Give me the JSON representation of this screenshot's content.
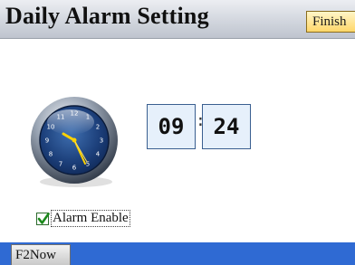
{
  "header": {
    "title": "Daily Alarm Setting",
    "finish_label": "Finish"
  },
  "clock": {
    "icon": "analog-clock-icon",
    "numerals": [
      "12",
      "1",
      "2",
      "3",
      "4",
      "5",
      "6",
      "7",
      "8",
      "9",
      "10",
      "11"
    ]
  },
  "time": {
    "hour": "09",
    "separator": ":",
    "minute": "24"
  },
  "alarm": {
    "enable_label": "Alarm Enable",
    "checked": true
  },
  "softkeys": {
    "left_label": "F2Now"
  },
  "colors": {
    "accent_bar": "#2f6ad3",
    "button_fill": "#ffd76a",
    "time_box_fill": "#e6f0fb",
    "clock_hands": "#ffd200"
  }
}
